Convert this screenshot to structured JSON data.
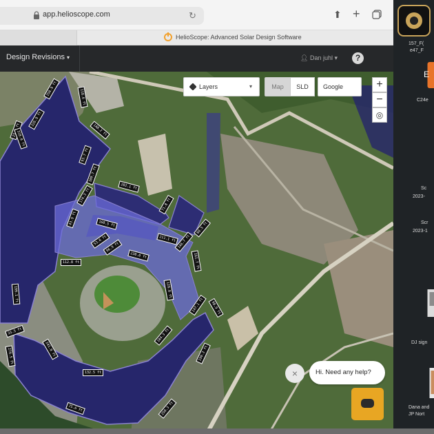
{
  "browser": {
    "url": "app.helioscope.com",
    "tab_title": "HelioScope: Advanced Solar Design Software"
  },
  "app_header": {
    "design_revisions": "Design Revisions",
    "user_name": "Dan juhl",
    "help_symbol": "?"
  },
  "map_controls": {
    "layers_label": "Layers",
    "map_label": "Map",
    "sld_label": "SLD",
    "provider_label": "Google",
    "zoom_in": "+",
    "zoom_out": "−",
    "locate_symbol": "◎"
  },
  "map_labels": {
    "tags": [
      "250.9 ft",
      "118.6 ft",
      "226.9 ft",
      "148.2 ft",
      "25.0 ft",
      "318.0 ft",
      "174.3 ft",
      "202.1 ft",
      "43.9 ft",
      "71.8 ft",
      "160.5 ft",
      "88.5 ft",
      "211.1 ft",
      "53.6 ft",
      "96.9 ft",
      "230.0 ft",
      "112.8 ft",
      "161.7 ft",
      "199.1 ft",
      "129.0 ft",
      "147.1 ft",
      "98.9 ft",
      "33.5 ft",
      "241.0 ft",
      "184.3 ft",
      "276.5 ft",
      "190.2 ft",
      "132.5 ft",
      "250.3 ft",
      "75.6 ft",
      "146.7 ft",
      "180.7 ft",
      "93.7 ft"
    ]
  },
  "chat": {
    "close_symbol": "×",
    "message": "Hi. Need any help?"
  },
  "desktop": {
    "labels": [
      "157_F(",
      "e47_F",
      "E",
      "C24e",
      "Sc",
      "2023-",
      "Scr",
      "2023-1",
      "DJ sign",
      "Dana and",
      "JP Nort"
    ]
  },
  "colors": {
    "header_bg": "#26282a",
    "panel_dark": "#2a2a6e",
    "panel_light": "#6b6bd8",
    "chat_accent": "#e8a623"
  }
}
